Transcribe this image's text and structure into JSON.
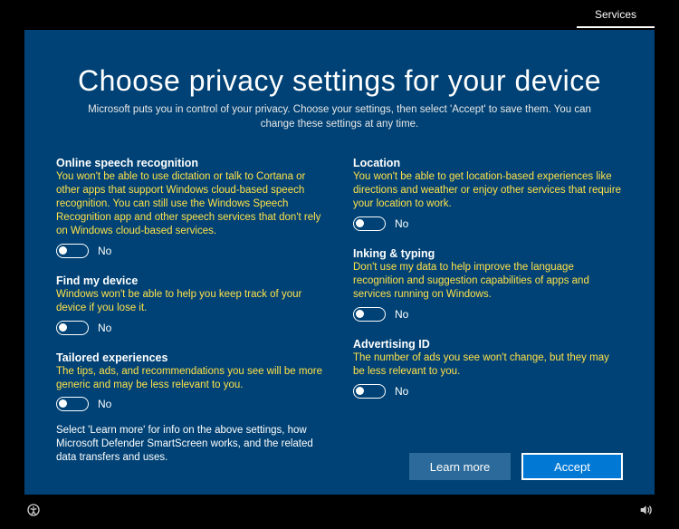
{
  "tab": "Services",
  "title": "Choose privacy settings for your device",
  "subtitle": "Microsoft puts you in control of your privacy. Choose your settings, then select 'Accept' to save them. You can change these settings at any time.",
  "settings": {
    "speech": {
      "title": "Online speech recognition",
      "desc": "You won't be able to use dictation or talk to Cortana or other apps that support Windows cloud-based speech recognition. You can still use the Windows Speech Recognition app and other speech services that don't rely on Windows cloud-based services.",
      "state": "No"
    },
    "findDevice": {
      "title": "Find my device",
      "desc": "Windows won't be able to help you keep track of your device if you lose it.",
      "state": "No"
    },
    "tailored": {
      "title": "Tailored experiences",
      "desc": "The tips, ads, and recommendations you see will be more generic and may be less relevant to you.",
      "state": "No"
    },
    "location": {
      "title": "Location",
      "desc": "You won't be able to get location-based experiences like directions and weather or enjoy other services that require your location to work.",
      "state": "No"
    },
    "inking": {
      "title": "Inking & typing",
      "desc": "Don't use my data to help improve the language recognition and suggestion capabilities of apps and services running on Windows.",
      "state": "No"
    },
    "adId": {
      "title": "Advertising ID",
      "desc": "The number of ads you see won't change, but they may be less relevant to you.",
      "state": "No"
    }
  },
  "footnote": "Select 'Learn more' for info on the above settings, how Microsoft Defender SmartScreen works, and the related data transfers and uses.",
  "buttons": {
    "learnMore": "Learn more",
    "accept": "Accept"
  }
}
